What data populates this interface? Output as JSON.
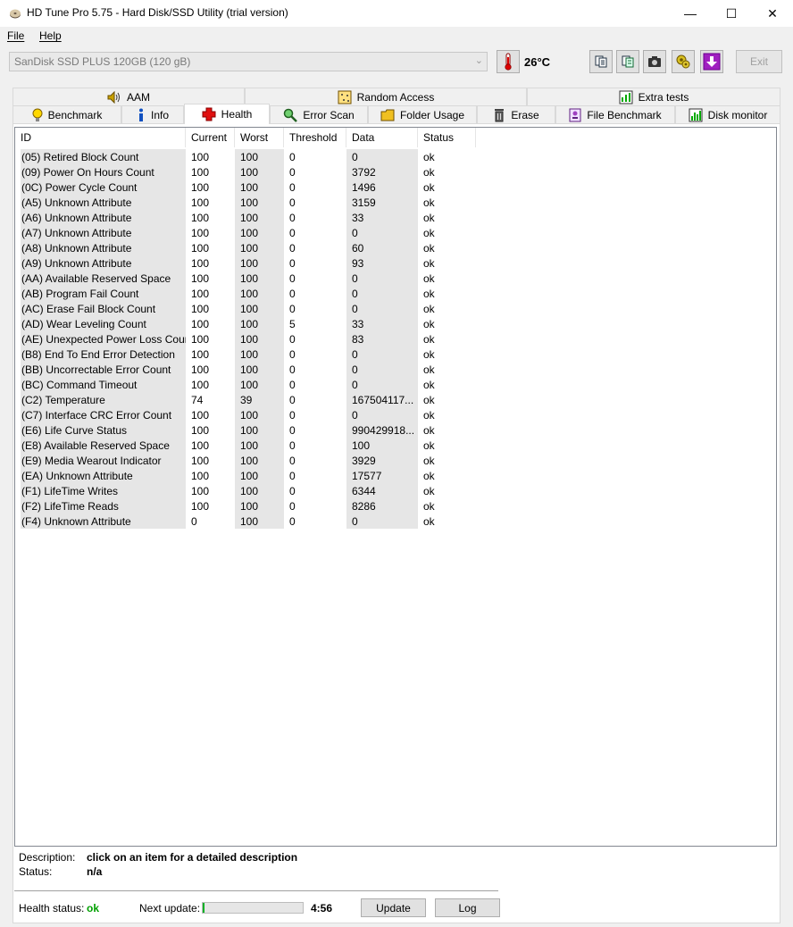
{
  "window": {
    "title": "HD Tune Pro 5.75 - Hard Disk/SSD Utility (trial version)",
    "minimize": "—",
    "maximize": "☐",
    "close": "✕"
  },
  "menu": {
    "file": "File",
    "help": "Help"
  },
  "toolbar": {
    "drive": "SanDisk SSD PLUS 120GB (120 gB)",
    "temperature": "26°C",
    "exit_label": "Exit"
  },
  "tabs": {
    "top": [
      {
        "label": "AAM",
        "icon": "speaker-icon"
      },
      {
        "label": "Random Access",
        "icon": "random-access-icon"
      },
      {
        "label": "Extra tests",
        "icon": "extra-tests-icon"
      }
    ],
    "bottom": [
      {
        "label": "Benchmark",
        "icon": "lightbulb-icon"
      },
      {
        "label": "Info",
        "icon": "info-icon"
      },
      {
        "label": "Health",
        "icon": "red-cross-icon"
      },
      {
        "label": "Error Scan",
        "icon": "magnifier-icon"
      },
      {
        "label": "Folder Usage",
        "icon": "folder-icon"
      },
      {
        "label": "Erase",
        "icon": "trash-icon"
      },
      {
        "label": "File Benchmark",
        "icon": "file-benchmark-icon"
      },
      {
        "label": "Disk monitor",
        "icon": "chart-icon"
      }
    ],
    "active": "Health"
  },
  "table": {
    "columns": [
      "ID",
      "Current",
      "Worst",
      "Threshold",
      "Data",
      "Status"
    ],
    "rows": [
      [
        "(05) Retired Block Count",
        "100",
        "100",
        "0",
        "0",
        "ok"
      ],
      [
        "(09) Power On Hours Count",
        "100",
        "100",
        "0",
        "3792",
        "ok"
      ],
      [
        "(0C) Power Cycle Count",
        "100",
        "100",
        "0",
        "1496",
        "ok"
      ],
      [
        "(A5) Unknown Attribute",
        "100",
        "100",
        "0",
        "3159",
        "ok"
      ],
      [
        "(A6) Unknown Attribute",
        "100",
        "100",
        "0",
        "33",
        "ok"
      ],
      [
        "(A7) Unknown Attribute",
        "100",
        "100",
        "0",
        "0",
        "ok"
      ],
      [
        "(A8) Unknown Attribute",
        "100",
        "100",
        "0",
        "60",
        "ok"
      ],
      [
        "(A9) Unknown Attribute",
        "100",
        "100",
        "0",
        "93",
        "ok"
      ],
      [
        "(AA) Available Reserved Space",
        "100",
        "100",
        "0",
        "0",
        "ok"
      ],
      [
        "(AB) Program Fail Count",
        "100",
        "100",
        "0",
        "0",
        "ok"
      ],
      [
        "(AC) Erase Fail Block Count",
        "100",
        "100",
        "0",
        "0",
        "ok"
      ],
      [
        "(AD) Wear Leveling Count",
        "100",
        "100",
        "5",
        "33",
        "ok"
      ],
      [
        "(AE) Unexpected Power Loss Count",
        "100",
        "100",
        "0",
        "83",
        "ok"
      ],
      [
        "(B8) End To End Error Detection",
        "100",
        "100",
        "0",
        "0",
        "ok"
      ],
      [
        "(BB) Uncorrectable Error Count",
        "100",
        "100",
        "0",
        "0",
        "ok"
      ],
      [
        "(BC) Command Timeout",
        "100",
        "100",
        "0",
        "0",
        "ok"
      ],
      [
        "(C2) Temperature",
        "74",
        "39",
        "0",
        "167504117...",
        "ok"
      ],
      [
        "(C7) Interface CRC Error Count",
        "100",
        "100",
        "0",
        "0",
        "ok"
      ],
      [
        "(E6) Life Curve Status",
        "100",
        "100",
        "0",
        "990429918...",
        "ok"
      ],
      [
        "(E8) Available Reserved Space",
        "100",
        "100",
        "0",
        "100",
        "ok"
      ],
      [
        "(E9) Media Wearout Indicator",
        "100",
        "100",
        "0",
        "3929",
        "ok"
      ],
      [
        "(EA) Unknown Attribute",
        "100",
        "100",
        "0",
        "17577",
        "ok"
      ],
      [
        "(F1) LifeTime Writes",
        "100",
        "100",
        "0",
        "6344",
        "ok"
      ],
      [
        "(F2) LifeTime Reads",
        "100",
        "100",
        "0",
        "8286",
        "ok"
      ],
      [
        "(F4) Unknown Attribute",
        "0",
        "100",
        "0",
        "0",
        "ok"
      ]
    ]
  },
  "details": {
    "description_label": "Description:",
    "description_value": "click on an item for a detailed description",
    "status_label": "Status:",
    "status_value": "n/a"
  },
  "footer": {
    "health_label": "Health status:",
    "health_value": "ok",
    "health_color": "#00a000",
    "next_update_label": "Next update:",
    "next_update_progress": 0.02,
    "countdown": "4:56",
    "update_label": "Update",
    "log_label": "Log"
  }
}
